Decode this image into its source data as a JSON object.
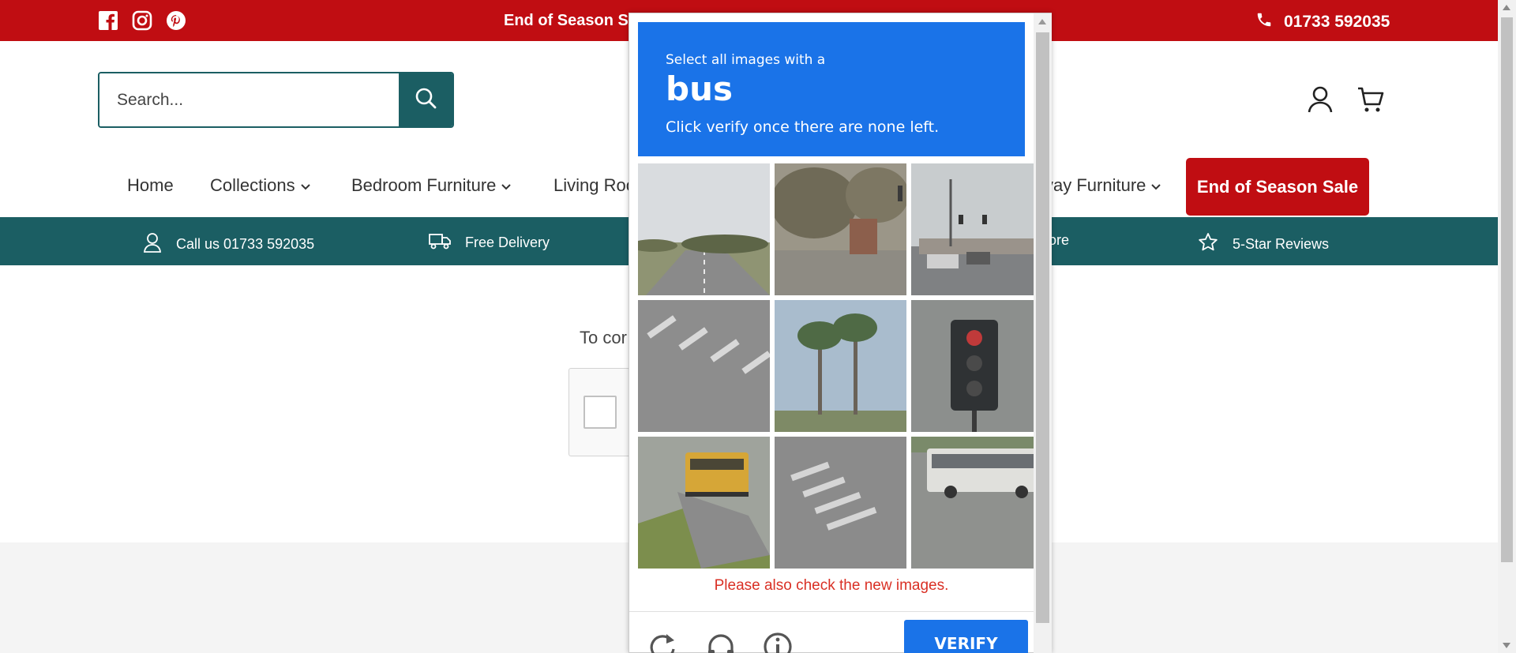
{
  "topbar": {
    "social_icons": [
      "facebook-icon",
      "instagram-icon",
      "pinterest-icon"
    ],
    "promo": "End of Season Sa",
    "phone": "01733 592035",
    "bg_color": "#c00d12"
  },
  "header": {
    "search_placeholder": "Search..."
  },
  "nav": {
    "items": [
      {
        "label": "Home",
        "has_dropdown": false
      },
      {
        "label": "Collections",
        "has_dropdown": true
      },
      {
        "label": "Bedroom Furniture",
        "has_dropdown": true
      },
      {
        "label": "Living Roo",
        "has_dropdown": false
      },
      {
        "label": "vay Furniture",
        "has_dropdown": true
      }
    ],
    "sale_button": "End of Season Sale"
  },
  "infobar": {
    "items": [
      {
        "icon": "user-icon",
        "label": "Call us 01733 592035"
      },
      {
        "icon": "truck-icon",
        "label": "Free Delivery"
      },
      {
        "icon": "",
        "label": "ore"
      },
      {
        "icon": "star-icon",
        "label": "5-Star Reviews"
      }
    ],
    "bg_color": "#1b5e63"
  },
  "content": {
    "text": "To cor"
  },
  "challenge": {
    "instruction_line1": "Select all images with a",
    "target": "bus",
    "instruction_line3": "Click verify once there are none left.",
    "tiles": [
      {
        "subject": "road"
      },
      {
        "subject": "trees-traffic-light"
      },
      {
        "subject": "intersection"
      },
      {
        "subject": "crosswalk"
      },
      {
        "subject": "palm-trees"
      },
      {
        "subject": "traffic-light"
      },
      {
        "subject": "school-bus"
      },
      {
        "subject": "crosswalk"
      },
      {
        "subject": "city-bus"
      }
    ],
    "error": "Please also check the new images.",
    "verify_label": "VERIFY",
    "controls": [
      "reload-icon",
      "audio-icon",
      "info-icon"
    ],
    "accent_color": "#1a73e8",
    "error_color": "#d93025"
  }
}
